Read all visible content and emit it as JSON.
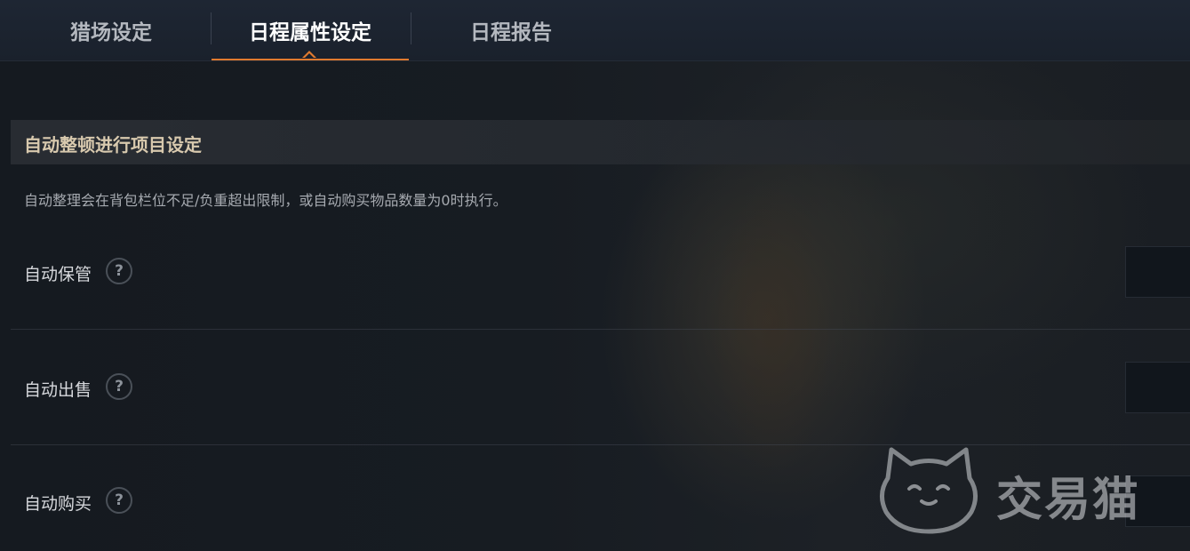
{
  "tabs": [
    {
      "label": "猎场设定",
      "active": false
    },
    {
      "label": "日程属性设定",
      "active": true
    },
    {
      "label": "日程报告",
      "active": false
    }
  ],
  "accent_color": "#e07a2e",
  "section": {
    "title": "自动整顿进行项目设定",
    "description": "自动整理会在背包栏位不足/负重超出限制，或自动购买物品数量为0时执行。"
  },
  "settings": [
    {
      "label": "自动保管",
      "help": "?"
    },
    {
      "label": "自动出售",
      "help": "?"
    },
    {
      "label": "自动购买",
      "help": "?"
    }
  ],
  "watermark": {
    "text": "交易猫"
  }
}
